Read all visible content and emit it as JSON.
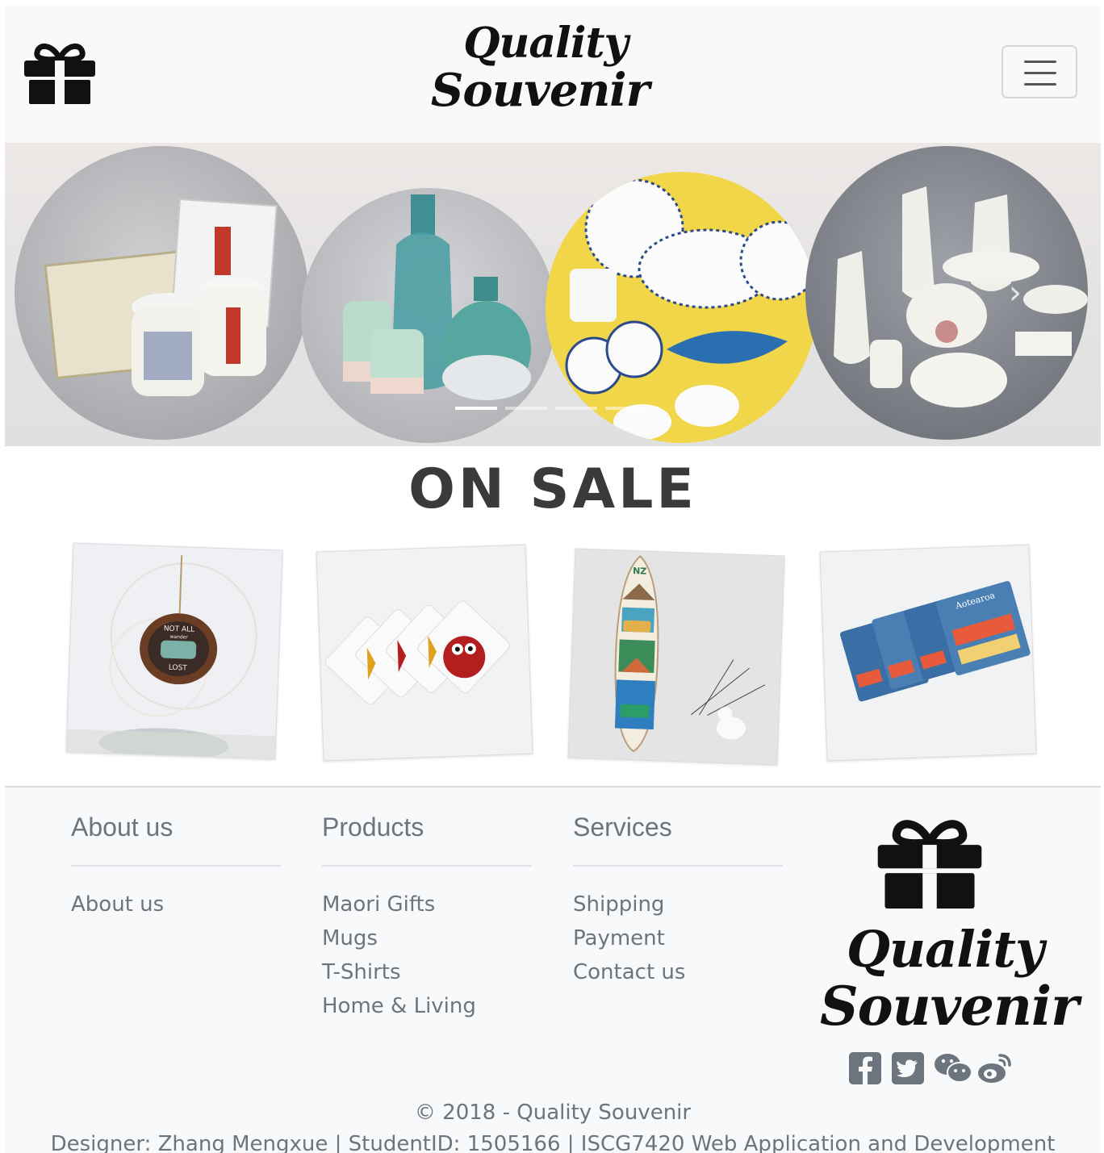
{
  "brand": {
    "line1": "Quality",
    "line2": "Souvenir"
  },
  "navbar": {
    "toggler_icon": "hamburger-icon",
    "gift_icon": "gift-icon"
  },
  "carousel": {
    "slides": [
      "slide-1",
      "slide-2",
      "slide-3",
      "slide-4"
    ],
    "active_index": 0,
    "next_icon": "chevron-right-icon",
    "next_glyph": "›"
  },
  "sale": {
    "title": "ON SALE",
    "items": [
      {
        "name": "sale-item-ornament",
        "text_top": "NOT ALL",
        "text_mid": "wander",
        "text_bottom": "LOST"
      },
      {
        "name": "sale-item-coasters-maori"
      },
      {
        "name": "sale-item-surfboard",
        "text_top": "NZ"
      },
      {
        "name": "sale-item-coasters-aotearoa",
        "text_top": "Aotearoa"
      }
    ]
  },
  "footer": {
    "about": {
      "heading": "About us",
      "links": [
        "About us"
      ]
    },
    "products": {
      "heading": "Products",
      "links": [
        "Maori Gifts",
        "Mugs",
        "T-Shirts",
        "Home & Living"
      ]
    },
    "services": {
      "heading": "Services",
      "links": [
        "Shipping",
        "Payment",
        "Contact us"
      ]
    },
    "brand": {
      "line1": "Quality",
      "line2": "Souvenir"
    },
    "social": [
      "facebook-icon",
      "twitter-icon",
      "wechat-icon",
      "weibo-icon"
    ],
    "copyright": "© 2018 - Quality Souvenir",
    "designer": "Designer: Zhang Mengxue | StudentID: 1505166 | ISCG7420 Web Application and Development"
  },
  "colors": {
    "text_muted": "#6c757d",
    "navbar_bg": "#f8f9fa",
    "dark": "#111111"
  }
}
